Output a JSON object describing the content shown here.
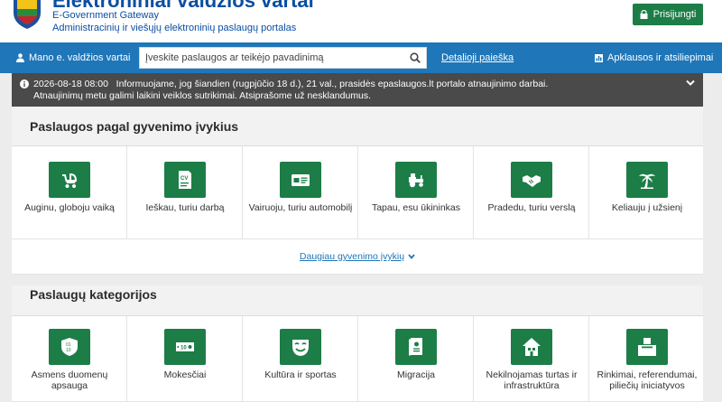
{
  "header": {
    "title": "Elektroniniai valdžios vartai",
    "subtitle_en": "E-Government Gateway",
    "subtitle_lt": "Administracinių ir viešųjų elektroninių paslaugų portalas",
    "login_label": "Prisijungti"
  },
  "nav": {
    "home_label": "Mano e. valdžios vartai",
    "search_placeholder": "Įveskite paslaugos ar teikėjo pavadinimą",
    "detailed_search_label": "Detalioji paieška",
    "polls_label": "Apklausos ir atsiliepimai"
  },
  "notice": {
    "timestamp": "2026-08-18 08:00",
    "text": "Informuojame, jog šiandien (rugpjūčio 18 d.), 21 val., prasidės epaslaugos.lt portalo atnaujinimo darbai. Atnaujinimų metu galimi laikini veiklos sutrikimai. Atsiprašome už nesklandumus."
  },
  "life_events": {
    "title": "Paslaugos pagal gyvenimo įvykius",
    "items": [
      {
        "label": "Auginu, globoju vaiką",
        "icon": "baby-carriage-icon"
      },
      {
        "label": "Ieškau, turiu darbą",
        "icon": "cv-document-icon"
      },
      {
        "label": "Vairuoju, turiu automobilį",
        "icon": "driver-license-icon"
      },
      {
        "label": "Tapau, esu ūkininkas",
        "icon": "tractor-icon"
      },
      {
        "label": "Pradedu, turiu verslą",
        "icon": "handshake-icon"
      },
      {
        "label": "Keliauju į užsienį",
        "icon": "palm-tree-icon"
      }
    ],
    "more_label": "Daugiau gyvenimo įvykių"
  },
  "categories": {
    "title": "Paslaugų kategorijos",
    "items": [
      {
        "label": "Asmens duomenų apsauga",
        "icon": "data-shield-icon"
      },
      {
        "label": "Mokesčiai",
        "icon": "banknote-icon"
      },
      {
        "label": "Kultūra ir sportas",
        "icon": "theatre-mask-icon"
      },
      {
        "label": "Migracija",
        "icon": "passport-icon"
      },
      {
        "label": "Nekilnojamas turtas ir infrastruktūra",
        "icon": "house-icon"
      },
      {
        "label": "Rinkimai, referendumai, piliečių iniciatyvos",
        "icon": "ballot-box-icon"
      }
    ]
  },
  "colors": {
    "brand_blue": "#1f76b8",
    "brand_green": "#1d7d47",
    "notice_bg": "#4a4a4a"
  }
}
